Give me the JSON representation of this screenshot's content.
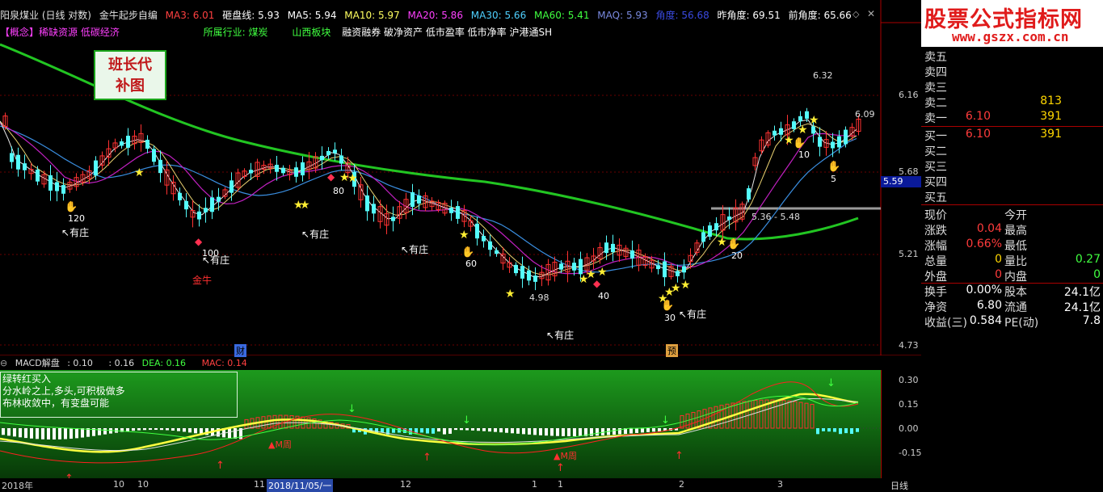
{
  "header": {
    "stock_name": "阳泉煤业 (日线 对数)",
    "formula_name": "金牛起步自编",
    "ma3": "MA3: 6.01",
    "support": "砸盘线: 5.93",
    "ma5": "MA5: 5.94",
    "ma10": "MA10: 5.97",
    "ma20": "MA20: 5.86",
    "ma30": "MA30: 5.66",
    "ma60": "MA60: 5.41",
    "maq": "MAQ: 5.93",
    "angle": "角度: 56.68",
    "prev_angle": "昨角度: 69.51",
    "front_angle": "前角度: 65.66"
  },
  "concept": {
    "concept": "【概念】稀缺资源 低碳经济",
    "industry": "所属行业: 煤炭",
    "sector": "山西板块",
    "tags": "融资融券 破净资产 低市盈率 低市净率 沪港通SH"
  },
  "sticker": {
    "line1": "班长代",
    "line2": "补图"
  },
  "colors": {
    "up": "#ff3232",
    "down": "#54fcfc",
    "ma_green": "#22c522",
    "ma_purple": "#c020c0",
    "ma_blue": "#3a8ee0",
    "ma_white": "#e8e8e8",
    "ma_yellow": "#e8d070",
    "grey": "#9a9a9a",
    "macd_bg_top": "#1d9a1d",
    "macd_bg_bottom": "#073807"
  },
  "price_axis": {
    "labels": [
      "6.16",
      "5.68",
      "5.21",
      "4.73"
    ],
    "current": "5.59"
  },
  "chart_labels": {
    "high_label": "6.32",
    "last_label": "6.09",
    "mid_range": "5.36 - 5.48",
    "low_label": "4.98",
    "jinniu": "金牛",
    "cai": "财",
    "yu": "预",
    "marks": [
      "120",
      "100",
      "80",
      "60",
      "40",
      "30",
      "20",
      "10",
      "5"
    ],
    "youzhuang": "有庄"
  },
  "macd": {
    "title": "MACD解盘",
    "v1": ": 0.10",
    "v2": ": 0.16",
    "dea": "DEA: 0.16",
    "mac": "MAC: 0.14",
    "axis": [
      "0.30",
      "0.15",
      "0.00",
      "-0.15"
    ],
    "note1": "绿转红买入",
    "note2": "分水岭之上,多头,可积极做多",
    "note3": "布林收敛中，有变盘可能",
    "mzhou": "M周"
  },
  "bottom_axis": {
    "labels": [
      "2018年",
      "10",
      "10",
      "11",
      "2018/11/05/一",
      "12",
      "1",
      "1",
      "2",
      "3"
    ],
    "period": "日线"
  },
  "site": {
    "title": "股票公式指标网",
    "url": "www.gszx.com.cn"
  },
  "order_book": {
    "asks": [
      {
        "label": "卖五",
        "price": "",
        "vol": ""
      },
      {
        "label": "卖四",
        "price": "",
        "vol": ""
      },
      {
        "label": "卖三",
        "price": "",
        "vol": ""
      },
      {
        "label": "卖二",
        "price": "",
        "vol": "813"
      },
      {
        "label": "卖一",
        "price": "6.10",
        "vol": "391"
      }
    ],
    "bids": [
      {
        "label": "买一",
        "price": "6.10",
        "vol": "391"
      },
      {
        "label": "买二",
        "price": "",
        "vol": ""
      },
      {
        "label": "买三",
        "price": "",
        "vol": ""
      },
      {
        "label": "买四",
        "price": "",
        "vol": ""
      },
      {
        "label": "买五",
        "price": "",
        "vol": ""
      }
    ]
  },
  "quote": [
    {
      "l1": "现价",
      "v1": "",
      "l2": "今开",
      "v2": ""
    },
    {
      "l1": "涨跌",
      "v1": "0.04",
      "l2": "最高",
      "v2": ""
    },
    {
      "l1": "涨幅",
      "v1": "0.66%",
      "l2": "最低",
      "v2": ""
    },
    {
      "l1": "总量",
      "v1": "0",
      "l2": "量比",
      "v2": "0.27"
    },
    {
      "l1": "外盘",
      "v1": "0",
      "l2": "内盘",
      "v2": "0"
    }
  ],
  "stats": [
    {
      "l1": "换手",
      "v1": "0.00%",
      "l2": "股本",
      "v2": "24.1亿"
    },
    {
      "l1": "净资",
      "v1": "6.80",
      "l2": "流通",
      "v2": "24.1亿"
    },
    {
      "l1": "收益(三)",
      "v1": "0.584",
      "l2": "PE(动)",
      "v2": "7.8"
    }
  ]
}
